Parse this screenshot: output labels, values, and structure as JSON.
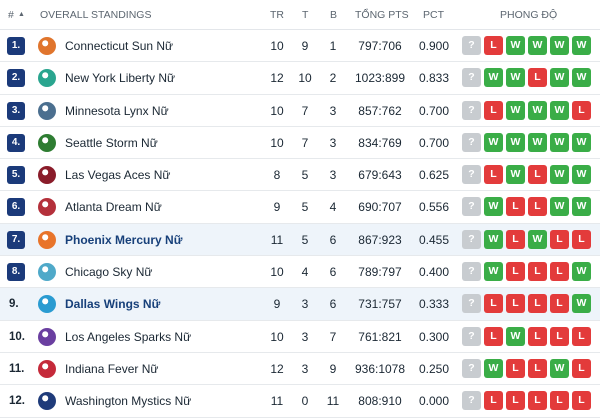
{
  "header": {
    "rank": "#",
    "sort_arrow": "▲",
    "title": "OVERALL STANDINGS",
    "played": "TR",
    "wins": "T",
    "losses": "B",
    "points": "TỔNG PTS",
    "pct": "PCT",
    "form": "PHONG ĐỘ"
  },
  "rows": [
    {
      "rank": "1.",
      "team": "Connecticut Sun Nữ",
      "played": "10",
      "wins": "9",
      "losses": "1",
      "points": "797:706",
      "pct": "0.900",
      "form": [
        "?",
        "L",
        "W",
        "W",
        "W",
        "W"
      ],
      "logo_color": "#e0752d",
      "highlight": false
    },
    {
      "rank": "2.",
      "team": "New York Liberty Nữ",
      "played": "12",
      "wins": "10",
      "losses": "2",
      "points": "1023:899",
      "pct": "0.833",
      "form": [
        "?",
        "W",
        "W",
        "L",
        "W",
        "W"
      ],
      "logo_color": "#2aa58f",
      "highlight": false
    },
    {
      "rank": "3.",
      "team": "Minnesota Lynx Nữ",
      "played": "10",
      "wins": "7",
      "losses": "3",
      "points": "857:762",
      "pct": "0.700",
      "form": [
        "?",
        "L",
        "W",
        "W",
        "W",
        "L"
      ],
      "logo_color": "#4b6f8f",
      "highlight": false
    },
    {
      "rank": "4.",
      "team": "Seattle Storm Nữ",
      "played": "10",
      "wins": "7",
      "losses": "3",
      "points": "834:769",
      "pct": "0.700",
      "form": [
        "?",
        "W",
        "W",
        "W",
        "W",
        "W"
      ],
      "logo_color": "#2e7d32",
      "highlight": false
    },
    {
      "rank": "5.",
      "team": "Las Vegas Aces Nữ",
      "played": "8",
      "wins": "5",
      "losses": "3",
      "points": "679:643",
      "pct": "0.625",
      "form": [
        "?",
        "L",
        "W",
        "L",
        "W",
        "W"
      ],
      "logo_color": "#8a1c2a",
      "highlight": false
    },
    {
      "rank": "6.",
      "team": "Atlanta Dream Nữ",
      "played": "9",
      "wins": "5",
      "losses": "4",
      "points": "690:707",
      "pct": "0.556",
      "form": [
        "?",
        "W",
        "L",
        "L",
        "W",
        "W"
      ],
      "logo_color": "#b4303b",
      "highlight": false
    },
    {
      "rank": "7.",
      "team": "Phoenix Mercury Nữ",
      "played": "11",
      "wins": "5",
      "losses": "6",
      "points": "867:923",
      "pct": "0.455",
      "form": [
        "?",
        "W",
        "L",
        "W",
        "L",
        "L"
      ],
      "logo_color": "#e8742a",
      "highlight": true
    },
    {
      "rank": "8.",
      "team": "Chicago Sky Nữ",
      "played": "10",
      "wins": "4",
      "losses": "6",
      "points": "789:797",
      "pct": "0.400",
      "form": [
        "?",
        "W",
        "L",
        "L",
        "L",
        "W"
      ],
      "logo_color": "#4fa9c9",
      "highlight": false
    },
    {
      "rank": "9.",
      "team": "Dallas Wings Nữ",
      "played": "9",
      "wins": "3",
      "losses": "6",
      "points": "731:757",
      "pct": "0.333",
      "form": [
        "?",
        "L",
        "L",
        "L",
        "L",
        "W"
      ],
      "logo_color": "#2a9bd1",
      "highlight": true
    },
    {
      "rank": "10.",
      "team": "Los Angeles Sparks Nữ",
      "played": "10",
      "wins": "3",
      "losses": "7",
      "points": "761:821",
      "pct": "0.300",
      "form": [
        "?",
        "L",
        "W",
        "L",
        "L",
        "L"
      ],
      "logo_color": "#6a3fa0",
      "highlight": false
    },
    {
      "rank": "11.",
      "team": "Indiana Fever Nữ",
      "played": "12",
      "wins": "3",
      "losses": "9",
      "points": "936:1078",
      "pct": "0.250",
      "form": [
        "?",
        "W",
        "L",
        "L",
        "W",
        "L"
      ],
      "logo_color": "#c52a3a",
      "highlight": false
    },
    {
      "rank": "12.",
      "team": "Washington Mystics Nữ",
      "played": "11",
      "wins": "0",
      "losses": "11",
      "points": "808:910",
      "pct": "0.000",
      "form": [
        "?",
        "L",
        "L",
        "L",
        "L",
        "L"
      ],
      "logo_color": "#1f3b7a",
      "highlight": false
    }
  ]
}
